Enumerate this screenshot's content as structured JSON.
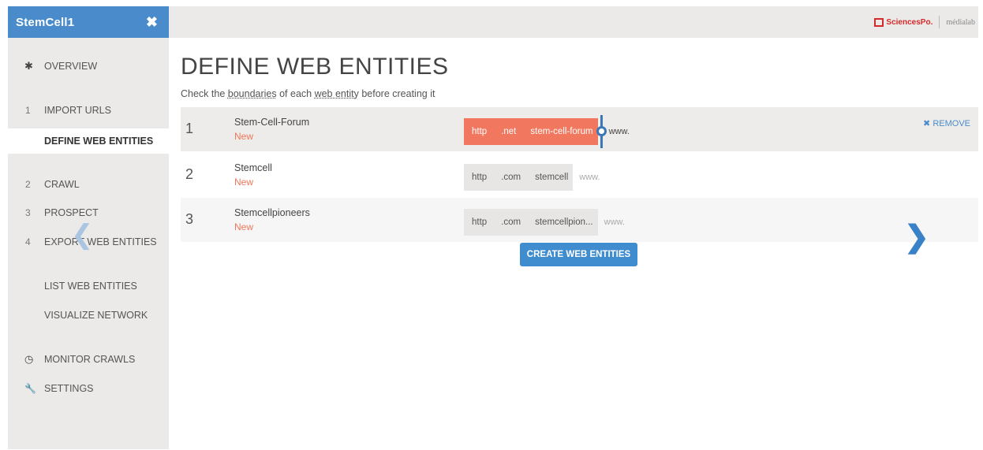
{
  "sidebar": {
    "project_name": "StemCell1",
    "close_icon": "close-icon",
    "items": [
      {
        "num": "",
        "icon": "✱",
        "label": "OVERVIEW"
      },
      {
        "num": "1",
        "icon": "",
        "label": "IMPORT URLS"
      },
      {
        "num": "",
        "icon": "",
        "label": "DEFINE WEB ENTITIES"
      },
      {
        "num": "2",
        "icon": "",
        "label": "CRAWL"
      },
      {
        "num": "3",
        "icon": "",
        "label": "PROSPECT"
      },
      {
        "num": "4",
        "icon": "",
        "label": "EXPORT WEB ENTITIES"
      },
      {
        "num": "",
        "icon": "",
        "label": "LIST WEB ENTITIES"
      },
      {
        "num": "",
        "icon": "",
        "label": "VISUALIZE NETWORK"
      },
      {
        "num": "",
        "icon": "◷",
        "label": "MONITOR CRAWLS"
      },
      {
        "num": "",
        "icon": "🔧",
        "label": "SETTINGS"
      }
    ]
  },
  "header": {
    "logo1": "SciencesPo.",
    "logo2": "médialab"
  },
  "main": {
    "title": "DEFINE WEB ENTITIES",
    "subtitle_prefix": "Check the ",
    "subtitle_u1": "boundaries",
    "subtitle_mid": " of each ",
    "subtitle_u2": "web entity",
    "subtitle_suffix": " before creating it",
    "rows": [
      {
        "num": "1",
        "name": "Stem-Cell-Forum",
        "status": "New",
        "stems": [
          "http",
          ".net",
          "stem-cell-forum"
        ],
        "www": "www."
      },
      {
        "num": "2",
        "name": "Stemcell",
        "status": "New",
        "stems": [
          "http",
          ".com",
          "stemcell"
        ],
        "www": "www."
      },
      {
        "num": "3",
        "name": "Stemcellpioneers",
        "status": "New",
        "stems": [
          "http",
          ".com",
          "stemcellpion..."
        ],
        "www": "www."
      }
    ],
    "remove_label": "✖ REMOVE",
    "create_button": "CREATE WEB ENTITIES"
  },
  "colors": {
    "accent": "#4a8ccb",
    "highlight": "#f2775f"
  }
}
